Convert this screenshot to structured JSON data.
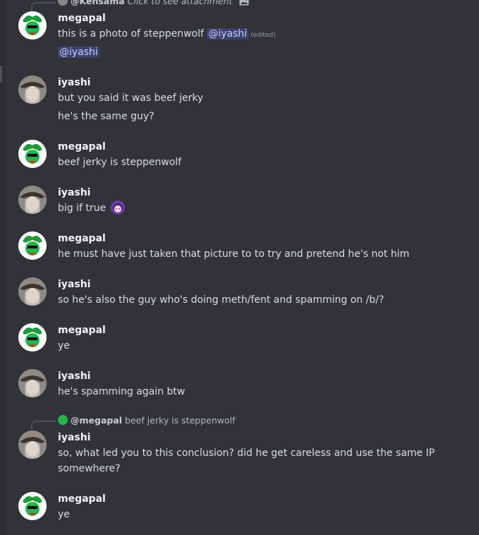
{
  "top_reply": {
    "author": "@Kensama",
    "text": "Click to see attachment",
    "icon": "image-icon"
  },
  "messages": [
    {
      "author": "megapal",
      "lines": [
        {
          "pre": "this is a photo of steppenwolf ",
          "mention": "@iyashi",
          "edited": "(edited)"
        },
        {
          "mention": "@iyashi"
        }
      ]
    },
    {
      "author": "iyashi",
      "lines": [
        {
          "text": "but you said it was beef jerky"
        },
        {
          "text": "he's the same guy?"
        }
      ]
    },
    {
      "author": "megapal",
      "lines": [
        {
          "text": "beef jerky is steppenwolf"
        }
      ]
    },
    {
      "author": "iyashi",
      "lines": [
        {
          "text": "big if true",
          "emoji": "anime-girl-emoji"
        }
      ]
    },
    {
      "author": "megapal",
      "lines": [
        {
          "text": "he must have just taken that picture to to try and pretend he's not him"
        }
      ]
    },
    {
      "author": "iyashi",
      "lines": [
        {
          "text": "so he's also the guy who's doing meth/fent and spamming on /b/?"
        }
      ]
    },
    {
      "author": "megapal",
      "lines": [
        {
          "text": "ye"
        }
      ]
    },
    {
      "author": "iyashi",
      "lines": [
        {
          "text": "he's spamming again btw"
        }
      ]
    },
    {
      "author": "iyashi",
      "reply": {
        "author": "@megapal",
        "text": "beef jerky is steppenwolf"
      },
      "lines": [
        {
          "text": "so, what led you to this conclusion? did he get careless and use the same IP"
        },
        {
          "text": "somewhere?"
        }
      ]
    },
    {
      "author": "megapal",
      "lines": [
        {
          "text": "ye"
        }
      ]
    }
  ],
  "colors": {
    "background": "#313338",
    "mention_bg": "#3c4270",
    "mention_fg": "#c9cdfb",
    "megapal_accent": "#2ea043"
  }
}
